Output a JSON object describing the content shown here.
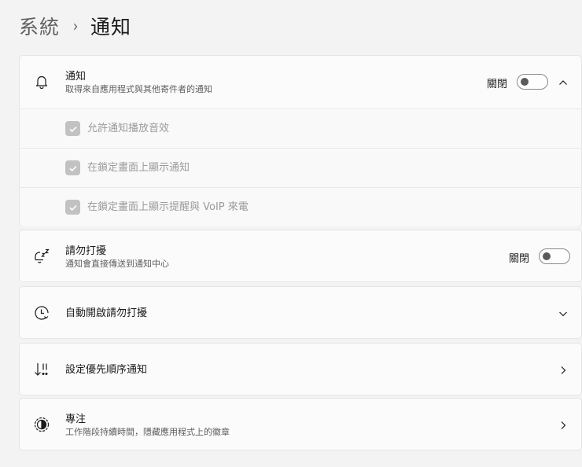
{
  "breadcrumb": {
    "parent": "系統",
    "separator": "›",
    "current": "通知"
  },
  "notifications": {
    "title": "通知",
    "subtitle": "取得來自應用程式與其他寄件者的通知",
    "toggle_label": "關閉",
    "toggle_on": false,
    "expanded": true,
    "options": [
      {
        "label": "允許通知播放音效",
        "checked": true,
        "disabled": true
      },
      {
        "label": "在鎖定畫面上顯示通知",
        "checked": true,
        "disabled": true
      },
      {
        "label": "在鎖定畫面上顯示提醒與 VoIP 來電",
        "checked": true,
        "disabled": true
      }
    ]
  },
  "do_not_disturb": {
    "title": "請勿打擾",
    "subtitle": "通知會直接傳送到通知中心",
    "toggle_label": "關閉",
    "toggle_on": false
  },
  "auto_dnd": {
    "title": "自動開啟請勿打擾"
  },
  "priority": {
    "title": "設定優先順序通知"
  },
  "focus": {
    "title": "專注",
    "subtitle": "工作階段持續時間，隱藏應用程式上的徽章"
  },
  "icons": {
    "notifications": "bell-icon",
    "do_not_disturb": "snooze-bell-icon",
    "auto_dnd": "clock-icon",
    "priority": "priority-sort-icon",
    "focus": "focus-icon"
  }
}
